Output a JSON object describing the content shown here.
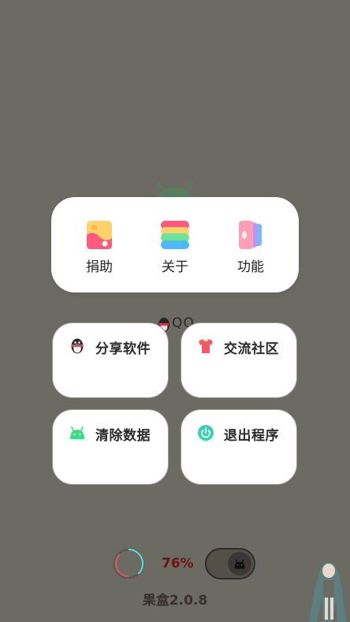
{
  "top_menu": {
    "items": [
      {
        "label": "捐助",
        "icon": "donate-icon"
      },
      {
        "label": "关于",
        "icon": "about-icon"
      },
      {
        "label": "功能",
        "icon": "features-icon"
      }
    ]
  },
  "background": {
    "qq_text": "QQ"
  },
  "cards": [
    {
      "label": "分享软件",
      "icon": "qq-penguin-icon"
    },
    {
      "label": "交流社区",
      "icon": "tshirt-icon"
    },
    {
      "label": "清除数据",
      "icon": "android-icon"
    },
    {
      "label": "退出程序",
      "icon": "power-icon"
    }
  ],
  "footer": {
    "percent": "76%",
    "progress": 0.76,
    "version": "果盒2.0.8"
  },
  "colors": {
    "background": "#6b6a63",
    "card": "#ffffff",
    "percent_text": "#6b1212",
    "android_green": "#3ddc84",
    "power_teal": "#34d1b3",
    "tshirt_red": "#ef5a66"
  }
}
